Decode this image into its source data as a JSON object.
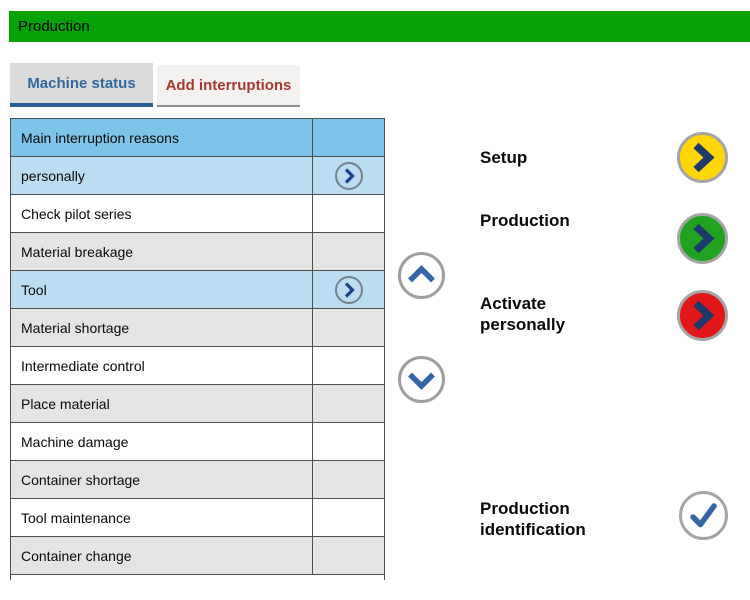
{
  "header": {
    "title": "Production"
  },
  "tabs": [
    {
      "label": "Machine status",
      "active": true
    },
    {
      "label": "Add interruptions",
      "active": false
    }
  ],
  "table": {
    "header": "Main interruption reasons",
    "rows": [
      {
        "label": "personally",
        "selected": true,
        "has_arrow": true
      },
      {
        "label": "Check pilot series",
        "selected": false,
        "has_arrow": false
      },
      {
        "label": "Material breakage",
        "selected": false,
        "has_arrow": false
      },
      {
        "label": "Tool",
        "selected": true,
        "has_arrow": true
      },
      {
        "label": "Material shortage",
        "selected": false,
        "has_arrow": false
      },
      {
        "label": "Intermediate control",
        "selected": false,
        "has_arrow": false
      },
      {
        "label": "Place material",
        "selected": false,
        "has_arrow": false
      },
      {
        "label": "Machine damage",
        "selected": false,
        "has_arrow": false
      },
      {
        "label": "Container shortage",
        "selected": false,
        "has_arrow": false
      },
      {
        "label": "Tool maintenance",
        "selected": false,
        "has_arrow": false
      },
      {
        "label": "Container change",
        "selected": false,
        "has_arrow": false
      }
    ]
  },
  "scroll": {
    "up_icon": "chevron-up-icon",
    "down_icon": "chevron-down-icon"
  },
  "actions": [
    {
      "label": "Setup",
      "icon": "chevron-right-icon",
      "color": "#FFD608",
      "name": "setup-button"
    },
    {
      "label": "Production",
      "icon": "chevron-right-icon",
      "color": "#21A321",
      "name": "production-button"
    },
    {
      "label": "Activate personally",
      "icon": "chevron-right-icon",
      "color": "#E21717",
      "name": "activate-personally-button"
    },
    {
      "label": "Production identification",
      "icon": "check-icon",
      "color": "#FFFFFF",
      "name": "production-identification-button"
    }
  ],
  "colors": {
    "header_green": "#05A305",
    "tab_active_text": "#31699E",
    "tab_active_underline": "#2D5E94",
    "tab_inactive_text": "#A33A34",
    "row_header_bg": "#7EC3E8",
    "row_selected_bg": "#BBDDF2",
    "row_gray_bg": "#E4E4E3",
    "table_border": "#4F4F4F",
    "row_arrow_chevron": "#1F3F8F",
    "scroll_chevron_blue": "#3465A4",
    "action_chevron_navy": "#1E3A6B",
    "check_blue": "#3465A4",
    "button_ring_gray": "#A5A5A5"
  }
}
